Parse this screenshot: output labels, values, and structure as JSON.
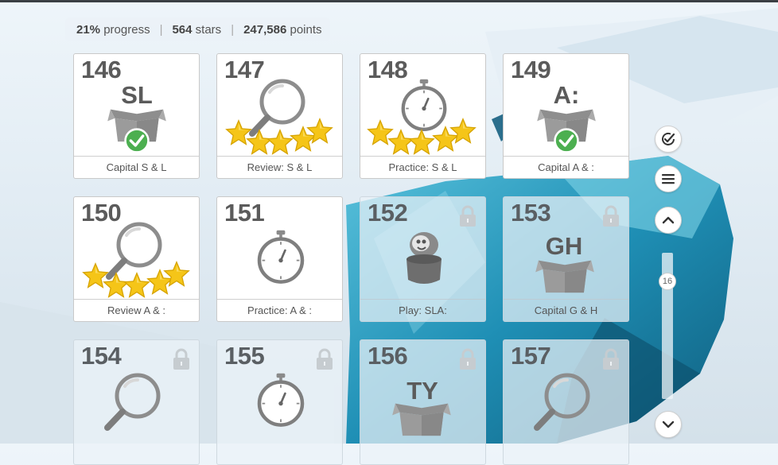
{
  "stats": {
    "progress_value": "21%",
    "progress_label": "progress",
    "stars_value": "564",
    "stars_label": "stars",
    "points_value": "247,586",
    "points_label": "points"
  },
  "cards": [
    {
      "number": "146",
      "caption": "Capital S & L",
      "icon": "box-letters-check-icon",
      "letters": "SL",
      "locked": false
    },
    {
      "number": "147",
      "caption": "Review: S & L",
      "icon": "magnifier-five-stars-icon",
      "locked": false
    },
    {
      "number": "148",
      "caption": "Practice: S & L",
      "icon": "stopwatch-five-stars-icon",
      "locked": false
    },
    {
      "number": "149",
      "caption": "Capital A & :",
      "icon": "box-letters-check-icon",
      "letters": "A:",
      "locked": false
    },
    {
      "number": "150",
      "caption": "Review A & :",
      "icon": "magnifier-five-stars-icon",
      "locked": false
    },
    {
      "number": "151",
      "caption": "Practice: A & :",
      "icon": "stopwatch-icon",
      "locked": false
    },
    {
      "number": "152",
      "caption": "Play: SLA:",
      "icon": "character-in-pot-icon",
      "locked": true
    },
    {
      "number": "153",
      "caption": "Capital G & H",
      "icon": "box-letters-icon",
      "letters": "GH",
      "locked": true
    },
    {
      "number": "154",
      "caption": "",
      "icon": "magnifier-icon",
      "locked": true
    },
    {
      "number": "155",
      "caption": "",
      "icon": "stopwatch-icon",
      "locked": true
    },
    {
      "number": "156",
      "caption": "",
      "icon": "box-letters-icon",
      "letters": "TY",
      "locked": true
    },
    {
      "number": "157",
      "caption": "",
      "icon": "magnifier-icon",
      "locked": true
    }
  ],
  "sidebar": {
    "buttons": [
      "check-circle-icon",
      "menu-icon",
      "chevron-up-icon",
      "chevron-down-icon"
    ],
    "scroll_value": "16"
  },
  "colors": {
    "star": "#f5c518",
    "check": "#4caf50",
    "icon_gray": "#8a8a8a",
    "ice": "#2a9bbf"
  }
}
